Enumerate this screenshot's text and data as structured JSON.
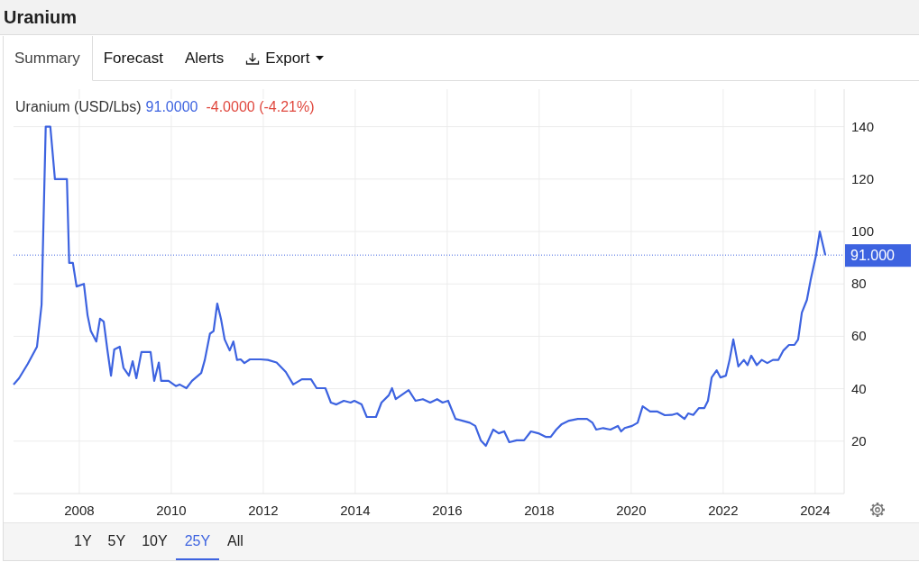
{
  "header": {
    "title": "Uranium"
  },
  "tabs": [
    {
      "label": "Summary",
      "kind": "tab",
      "selected": true
    },
    {
      "label": "Forecast",
      "kind": "tab",
      "selected": false
    },
    {
      "label": "Alerts",
      "kind": "tab",
      "selected": false
    },
    {
      "label": "Export",
      "kind": "menu",
      "selected": false
    }
  ],
  "chart": {
    "legend": {
      "price": "91.0000",
      "change": "-4.0000 (-4.21%)"
    },
    "chart_data": {
      "type": "line",
      "xlim": [
        2006.57,
        2024.63
      ],
      "ylim": [
        0,
        154.3
      ],
      "grid": true,
      "xticks": [
        2008,
        2010,
        2012,
        2014,
        2016,
        2018,
        2020,
        2022,
        2024
      ],
      "yticks": [
        20,
        40,
        60,
        80,
        100,
        120,
        140
      ],
      "x": [
        2006.57,
        2006.69,
        2006.88,
        2007.08,
        2007.18,
        2007.27,
        2007.37,
        2007.47,
        2007.73,
        2007.78,
        2007.86,
        2007.94,
        2008.1,
        2008.18,
        2008.25,
        2008.37,
        2008.45,
        2008.53,
        2008.61,
        2008.69,
        2008.76,
        2008.88,
        2008.96,
        2009.08,
        2009.16,
        2009.24,
        2009.35,
        2009.55,
        2009.63,
        2009.73,
        2009.78,
        2009.94,
        2010.1,
        2010.18,
        2010.33,
        2010.45,
        2010.65,
        2010.73,
        2010.84,
        2010.92,
        2011.0,
        2011.08,
        2011.16,
        2011.27,
        2011.35,
        2011.43,
        2011.51,
        2011.59,
        2011.71,
        2011.94,
        2012.1,
        2012.29,
        2012.49,
        2012.65,
        2012.84,
        2013.04,
        2013.16,
        2013.35,
        2013.47,
        2013.59,
        2013.75,
        2013.9,
        2013.98,
        2014.14,
        2014.25,
        2014.45,
        2014.57,
        2014.73,
        2014.8,
        2014.88,
        2015.0,
        2015.16,
        2015.31,
        2015.47,
        2015.63,
        2015.78,
        2015.9,
        2016.02,
        2016.18,
        2016.33,
        2016.49,
        2016.61,
        2016.73,
        2016.84,
        2017.0,
        2017.12,
        2017.24,
        2017.35,
        2017.51,
        2017.67,
        2017.82,
        2017.98,
        2018.14,
        2018.25,
        2018.37,
        2018.49,
        2018.65,
        2018.84,
        2019.04,
        2019.16,
        2019.24,
        2019.39,
        2019.55,
        2019.71,
        2019.78,
        2019.86,
        2020.02,
        2020.14,
        2020.25,
        2020.41,
        2020.57,
        2020.73,
        2020.88,
        2021.0,
        2021.16,
        2021.24,
        2021.35,
        2021.47,
        2021.59,
        2021.67,
        2021.75,
        2021.86,
        2021.94,
        2022.06,
        2022.14,
        2022.22,
        2022.33,
        2022.45,
        2022.53,
        2022.61,
        2022.73,
        2022.84,
        2022.96,
        2023.08,
        2023.2,
        2023.31,
        2023.43,
        2023.55,
        2023.63,
        2023.71,
        2023.82,
        2023.9,
        2024.02,
        2024.1,
        2024.22
      ],
      "series": [
        {
          "name": "Uranium (USD/Lbs)",
          "color": "#3d63e0",
          "values": [
            41.6,
            44,
            49.5,
            56,
            72,
            140,
            140,
            120,
            120,
            88,
            88,
            79,
            80,
            68,
            62,
            58,
            66.7,
            65.6,
            55,
            45,
            55,
            56,
            48,
            45,
            50.5,
            44,
            54,
            54,
            43,
            50,
            43,
            43,
            41,
            41.6,
            40.2,
            43,
            46,
            51,
            61,
            62,
            72.5,
            66.7,
            58.8,
            54.6,
            58,
            51,
            51.2,
            49.8,
            51.2,
            51.2,
            51,
            50,
            46.4,
            41.6,
            43.6,
            43.6,
            40.2,
            40.2,
            34.7,
            34,
            35.4,
            34.7,
            35.4,
            34,
            29.2,
            29.2,
            34.7,
            37.5,
            40.2,
            36,
            37.5,
            39.5,
            35.4,
            36,
            34.7,
            36,
            34.7,
            35.4,
            28.5,
            27.8,
            27,
            25.8,
            20.3,
            18.2,
            24.4,
            23,
            23.7,
            19.6,
            20.3,
            20.3,
            23.7,
            23,
            21.6,
            21.6,
            24.4,
            26.5,
            27.8,
            28.5,
            28.5,
            27,
            24.4,
            25,
            24.4,
            25.8,
            23.7,
            25,
            25.8,
            27,
            33.3,
            31.3,
            31.3,
            29.9,
            30,
            30.6,
            28.5,
            30.6,
            30,
            32.6,
            32.6,
            35.4,
            44.3,
            47,
            44.3,
            45,
            51,
            58.8,
            48.5,
            51,
            49,
            52.6,
            49,
            51,
            49.8,
            51,
            51,
            54.6,
            56.7,
            56.7,
            58.8,
            69,
            73.9,
            81.4,
            91,
            100,
            91
          ]
        }
      ],
      "ref_lines": [
        {
          "axis": "y",
          "value": 91,
          "label": "91.000"
        }
      ]
    }
  },
  "ranges": [
    {
      "label": "1Y",
      "selected": false
    },
    {
      "label": "5Y",
      "selected": false
    },
    {
      "label": "10Y",
      "selected": false
    },
    {
      "label": "25Y",
      "selected": true
    },
    {
      "label": "All",
      "selected": false
    }
  ]
}
